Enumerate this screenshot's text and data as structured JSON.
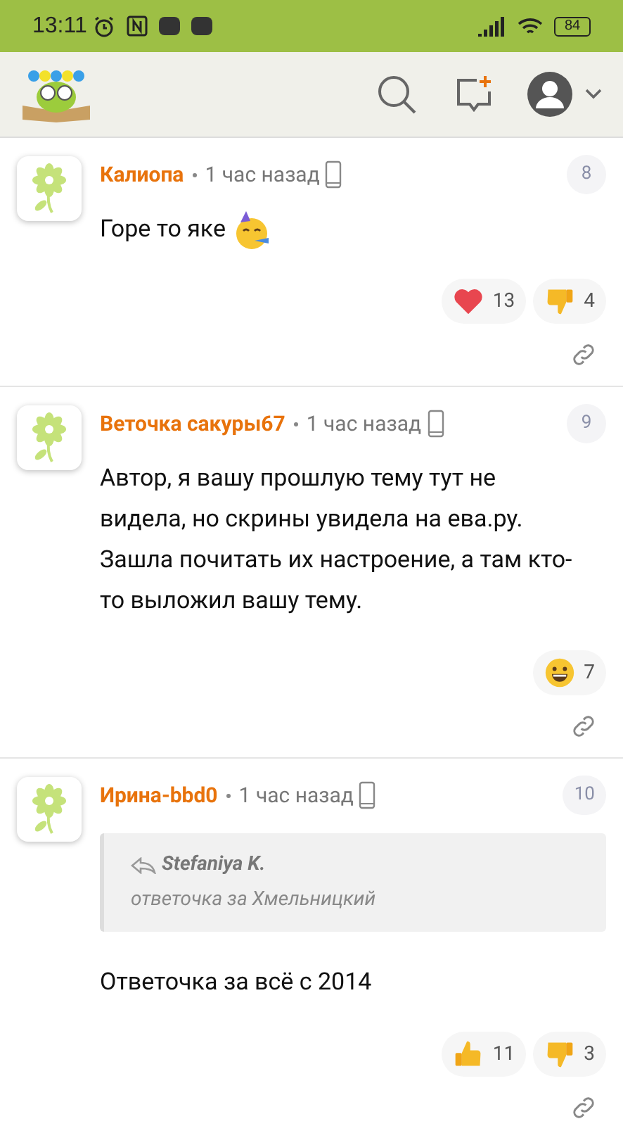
{
  "status_bar": {
    "time": "13:11",
    "battery": "84"
  },
  "comments": [
    {
      "author": "Калиопа",
      "time": "1 час назад",
      "number": "8",
      "text": "Горе то яке",
      "emoji": {
        "kind": "party"
      },
      "reactions": [
        {
          "kind": "heart",
          "count": "13"
        },
        {
          "kind": "dislike",
          "count": "4"
        }
      ]
    },
    {
      "author": "Веточка сакуры67",
      "time": "1 час назад",
      "number": "9",
      "text": "Автор, я вашу прошлую тему тут не видела, но скрины увидела на ева.ру. Зашла почитать их настроение, а там кто-то выложил вашу тему.",
      "reactions": [
        {
          "kind": "smile",
          "count": "7"
        }
      ]
    },
    {
      "author": "Ирина-bbd0",
      "time": "1 час назад",
      "number": "10",
      "quote": {
        "author": "Stefaniya K.",
        "text": "ответочка за Хмельницкий"
      },
      "text": "Ответочка за всё с 2014",
      "reactions": [
        {
          "kind": "like",
          "count": "11"
        },
        {
          "kind": "dislike",
          "count": "3"
        }
      ]
    }
  ]
}
